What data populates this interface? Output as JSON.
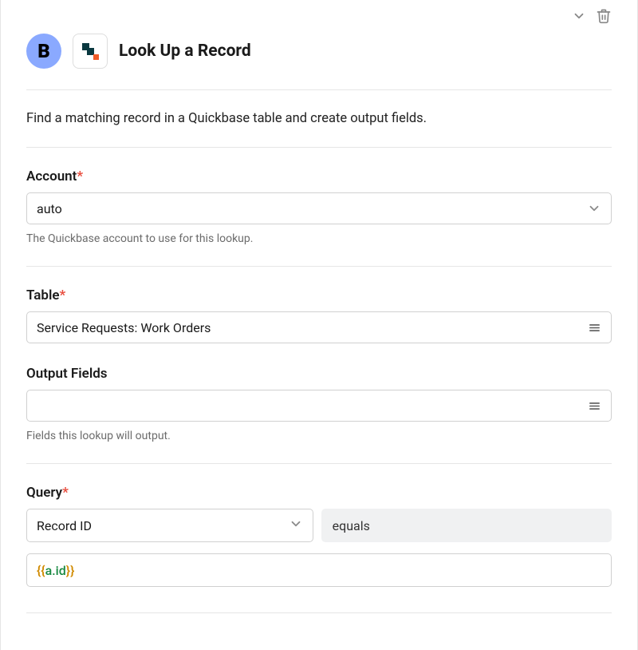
{
  "avatar_letter": "B",
  "card_title": "Look Up a Record",
  "description": "Find a matching record in a Quickbase table and create output fields.",
  "required_mark": "*",
  "account": {
    "label": "Account",
    "value": "auto",
    "help": "The Quickbase account to use for this lookup."
  },
  "table": {
    "label": "Table",
    "value": "Service Requests: Work Orders"
  },
  "output_fields": {
    "label": "Output Fields",
    "value": "",
    "help": "Fields this lookup will output."
  },
  "query": {
    "label": "Query",
    "field_value": "Record ID",
    "operator": "equals",
    "value_open": "{{",
    "value_var": "a.id",
    "value_close": "}}"
  }
}
